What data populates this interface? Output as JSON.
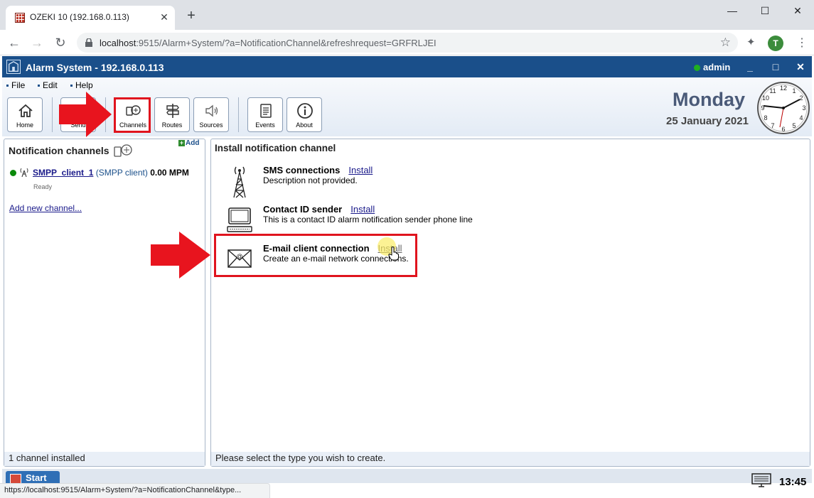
{
  "browser": {
    "tab_title": "OZEKI 10 (192.168.0.113)",
    "url_host": "localhost",
    "url_rest": ":9515/Alarm+System/?a=NotificationChannel&refreshrequest=GRFRLJEI",
    "profile_initial": "T",
    "status_url": "https://localhost:9515/Alarm+System/?a=NotificationChannel&type..."
  },
  "app": {
    "title": "Alarm System - 192.168.0.113",
    "user": "admin",
    "menu": [
      "File",
      "Edit",
      "Help"
    ],
    "toolbar": {
      "home": "Home",
      "send": "Send",
      "channels": "Channels",
      "routes": "Routes",
      "sources": "Sources",
      "events": "Events",
      "about": "About"
    },
    "day": "Monday",
    "date": "25 January 2021",
    "time": "13:45",
    "start": "Start"
  },
  "left_panel": {
    "heading": "Notification channels",
    "add": "Add",
    "channel": {
      "name": "SMPP_client_1",
      "type": "(SMPP client)",
      "rate": "0.00 MPM",
      "state": "Ready"
    },
    "add_channel": "Add new channel...",
    "footer": "1 channel installed"
  },
  "right_panel": {
    "heading": "Install notification channel",
    "options": [
      {
        "title": "SMS connections",
        "link": "Install",
        "desc": "Description not provided.",
        "icon": "antenna-tower-icon"
      },
      {
        "title": "Contact ID sender",
        "link": "Install",
        "desc": "This is a contact ID alarm notification sender phone line",
        "icon": "computer-icon"
      },
      {
        "title": "E-mail client connection",
        "link": "Install",
        "desc": "Create an e-mail network connections.",
        "icon": "email-envelope-icon"
      }
    ],
    "footer": "Please select the type you wish to create."
  },
  "colors": {
    "titlebar": "#1a4f8a",
    "highlight": "#e0141e",
    "link": "#1a1a8a"
  }
}
